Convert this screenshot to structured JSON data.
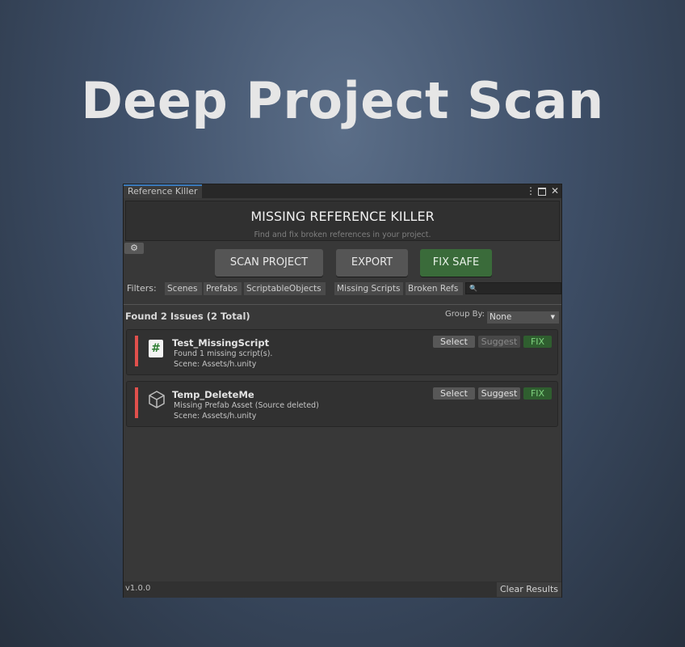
{
  "hero": {
    "title": "Deep Project Scan"
  },
  "window": {
    "tab_title": "Reference Killer",
    "menu_glyph": "⋮",
    "close_glyph": "✕"
  },
  "header": {
    "title": "MISSING REFERENCE KILLER",
    "subtitle": "Find and fix broken references in your project."
  },
  "toolbar": {
    "settings_icon": "⚙",
    "scan_label": "SCAN PROJECT",
    "export_label": "EXPORT",
    "fix_safe_label": "FIX SAFE"
  },
  "filters": {
    "label": "Filters:",
    "chips": [
      "Scenes",
      "Prefabs",
      "ScriptableObjects",
      "Missing Scripts",
      "Broken Refs"
    ],
    "search_icon": "🔍",
    "search_value": ""
  },
  "results": {
    "summary": "Found 2 Issues (2 Total)",
    "group_by_label": "Group By:",
    "group_by_value": "None",
    "dropdown_arrow": "▼"
  },
  "issues": [
    {
      "name": "Test_MissingScript",
      "description": "Found 1 missing script(s).",
      "path": "Scene: Assets/h.unity",
      "icon": "script-icon",
      "icon_glyph": "#",
      "select_label": "Select",
      "suggest_label": "Suggest",
      "suggest_enabled": false,
      "fix_label": "FIX"
    },
    {
      "name": "Temp_DeleteMe",
      "description": "Missing Prefab Asset (Source deleted)",
      "path": "Scene: Assets/h.unity",
      "icon": "cube-icon",
      "select_label": "Select",
      "suggest_label": "Suggest",
      "suggest_enabled": true,
      "fix_label": "FIX"
    }
  ],
  "footer": {
    "version": "v1.0.0",
    "clear_label": "Clear Results"
  },
  "colors": {
    "severity": "#e0504c",
    "fix_safe": "#3a6b3a",
    "fix_text": "#7fd27f",
    "tab_accent": "#3a79bb"
  }
}
